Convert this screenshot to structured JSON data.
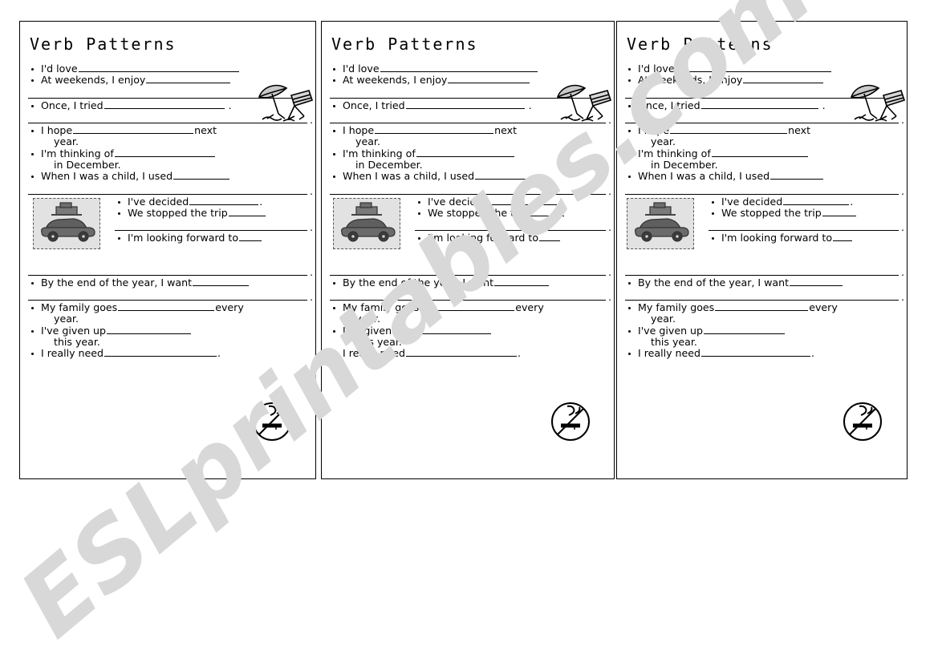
{
  "document": {
    "kind": "esl-worksheet",
    "watermark": "ESLprintables.com",
    "watermark_color": "#d8d8d8",
    "background_color": "#ffffff",
    "ink_color": "#000000",
    "card_count": 3
  },
  "card": {
    "title": "Verb Patterns",
    "items": [
      {
        "id": "id-love",
        "text": "I'd love",
        "rule": 200,
        "tail": "",
        "cont": "",
        "after_full_rule": false
      },
      {
        "id": "at-weekends",
        "text": "At weekends, I enjoy",
        "rule": 105,
        "tail": "",
        "cont": "",
        "after_full_rule": true
      },
      {
        "id": "once-i-tried",
        "text": "Once, I tried",
        "rule": 150,
        "tail": ".",
        "cont": "",
        "after_full_rule": true
      },
      {
        "id": "i-hope",
        "text": "I hope",
        "rule": 150,
        "tail": "next",
        "cont": "year.",
        "after_full_rule": false
      },
      {
        "id": "im-thinking-of",
        "text": "I'm thinking of",
        "rule": 125,
        "tail": "",
        "cont": "in December.",
        "after_full_rule": false
      },
      {
        "id": "when-child",
        "text": "When I was a child, I used",
        "rule": 70,
        "tail": "",
        "cont": "",
        "after_full_rule": true
      }
    ],
    "car_items": [
      {
        "id": "ive-decided",
        "text": "I've decided",
        "rule": 86,
        "tail": ".",
        "after_full_rule": false
      },
      {
        "id": "we-stopped",
        "text": "We stopped the trip",
        "rule": 46,
        "tail": "",
        "after_full_rule": true
      },
      {
        "id": "looking-forward",
        "text": "I'm looking forward to",
        "rule": 28,
        "tail": "",
        "after_full_rule": true
      }
    ],
    "tail_items": [
      {
        "id": "by-end-of-year",
        "text": "By the end of the year, I want",
        "rule": 70,
        "tail": "",
        "cont": "",
        "after_full_rule": true
      },
      {
        "id": "my-family-goes",
        "text": "My family goes",
        "rule": 120,
        "tail": "every",
        "cont": "year.",
        "after_full_rule": false
      },
      {
        "id": "ive-given-up",
        "text": "I've given up",
        "rule": 105,
        "tail": "",
        "cont": "this year.",
        "after_full_rule": false
      },
      {
        "id": "i-really-need",
        "text": "I really need",
        "rule": 140,
        "tail": ".",
        "cont": "",
        "after_full_rule": false
      }
    ],
    "clipart": [
      {
        "name": "beach-umbrella-deckchair-icon",
        "label": "beach umbrella and deck chair"
      },
      {
        "name": "car-with-luggage-icon",
        "label": "car with luggage on roof rack"
      },
      {
        "name": "no-smoking-icon",
        "label": "no smoking sign"
      }
    ]
  }
}
